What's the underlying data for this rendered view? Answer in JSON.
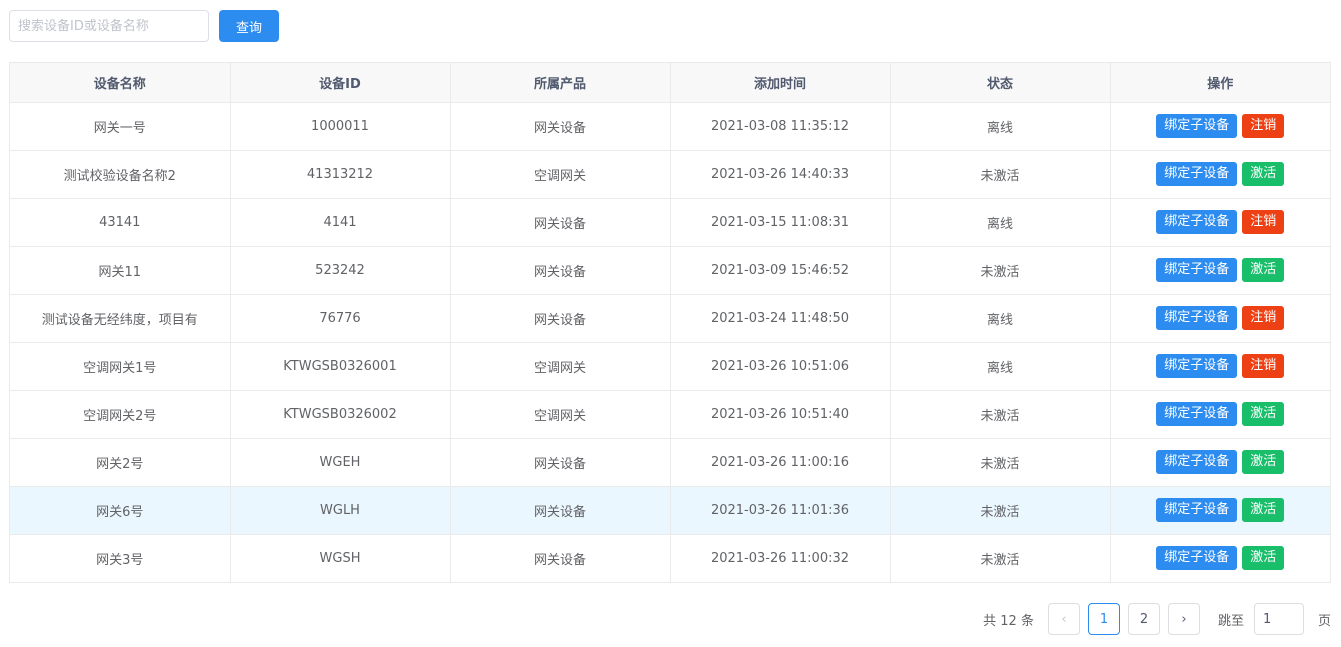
{
  "search": {
    "placeholder": "搜索设备ID或设备名称",
    "value": ""
  },
  "toolbar": {
    "query_label": "查询"
  },
  "table": {
    "headers": [
      "设备名称",
      "设备ID",
      "所属产品",
      "添加时间",
      "状态",
      "操作"
    ],
    "bind_label": "绑定子设备",
    "rows": [
      {
        "name": "网关一号",
        "id": "1000011",
        "product": "网关设备",
        "time": "2021-03-08 11:35:12",
        "status": "离线",
        "action": "注销",
        "action_type": "danger"
      },
      {
        "name": "测试校验设备名称2",
        "id": "41313212",
        "product": "空调网关",
        "time": "2021-03-26 14:40:33",
        "status": "未激活",
        "action": "激活",
        "action_type": "success"
      },
      {
        "name": "43141",
        "id": "4141",
        "product": "网关设备",
        "time": "2021-03-15 11:08:31",
        "status": "离线",
        "action": "注销",
        "action_type": "danger"
      },
      {
        "name": "网关11",
        "id": "523242",
        "product": "网关设备",
        "time": "2021-03-09 15:46:52",
        "status": "未激活",
        "action": "激活",
        "action_type": "success"
      },
      {
        "name": "测试设备无经纬度，项目有",
        "id": "76776",
        "product": "网关设备",
        "time": "2021-03-24 11:48:50",
        "status": "离线",
        "action": "注销",
        "action_type": "danger"
      },
      {
        "name": "空调网关1号",
        "id": "KTWGSB0326001",
        "product": "空调网关",
        "time": "2021-03-26 10:51:06",
        "status": "离线",
        "action": "注销",
        "action_type": "danger"
      },
      {
        "name": "空调网关2号",
        "id": "KTWGSB0326002",
        "product": "空调网关",
        "time": "2021-03-26 10:51:40",
        "status": "未激活",
        "action": "激活",
        "action_type": "success"
      },
      {
        "name": "网关2号",
        "id": "WGEH",
        "product": "网关设备",
        "time": "2021-03-26 11:00:16",
        "status": "未激活",
        "action": "激活",
        "action_type": "success"
      },
      {
        "name": "网关6号",
        "id": "WGLH",
        "product": "网关设备",
        "time": "2021-03-26 11:01:36",
        "status": "未激活",
        "action": "激活",
        "action_type": "success"
      },
      {
        "name": "网关3号",
        "id": "WGSH",
        "product": "网关设备",
        "time": "2021-03-26 11:00:32",
        "status": "未激活",
        "action": "激活",
        "action_type": "success"
      }
    ],
    "highlighted_row": 8
  },
  "pagination": {
    "total_label": "共 12 条",
    "prev_icon": "‹",
    "next_icon": "›",
    "pages": [
      "1",
      "2"
    ],
    "current": "1",
    "jump_label": "跳至",
    "jump_value": "1",
    "page_suffix": "页"
  },
  "colors": {
    "primary": "#2d8cf0",
    "danger": "#ed4014",
    "success": "#19be6b",
    "highlight_row": "#ebf7ff"
  }
}
